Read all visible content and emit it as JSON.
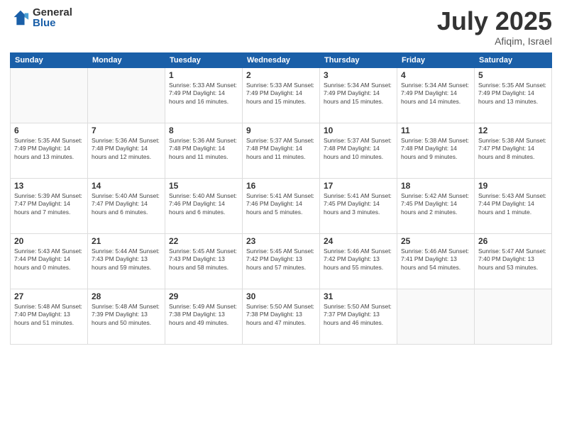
{
  "logo": {
    "general": "General",
    "blue": "Blue"
  },
  "title": {
    "month_year": "July 2025",
    "location": "Afiqim, Israel"
  },
  "weekdays": [
    "Sunday",
    "Monday",
    "Tuesday",
    "Wednesday",
    "Thursday",
    "Friday",
    "Saturday"
  ],
  "weeks": [
    [
      {
        "day": "",
        "info": ""
      },
      {
        "day": "",
        "info": ""
      },
      {
        "day": "1",
        "info": "Sunrise: 5:33 AM\nSunset: 7:49 PM\nDaylight: 14 hours and 16 minutes."
      },
      {
        "day": "2",
        "info": "Sunrise: 5:33 AM\nSunset: 7:49 PM\nDaylight: 14 hours and 15 minutes."
      },
      {
        "day": "3",
        "info": "Sunrise: 5:34 AM\nSunset: 7:49 PM\nDaylight: 14 hours and 15 minutes."
      },
      {
        "day": "4",
        "info": "Sunrise: 5:34 AM\nSunset: 7:49 PM\nDaylight: 14 hours and 14 minutes."
      },
      {
        "day": "5",
        "info": "Sunrise: 5:35 AM\nSunset: 7:49 PM\nDaylight: 14 hours and 13 minutes."
      }
    ],
    [
      {
        "day": "6",
        "info": "Sunrise: 5:35 AM\nSunset: 7:49 PM\nDaylight: 14 hours and 13 minutes."
      },
      {
        "day": "7",
        "info": "Sunrise: 5:36 AM\nSunset: 7:48 PM\nDaylight: 14 hours and 12 minutes."
      },
      {
        "day": "8",
        "info": "Sunrise: 5:36 AM\nSunset: 7:48 PM\nDaylight: 14 hours and 11 minutes."
      },
      {
        "day": "9",
        "info": "Sunrise: 5:37 AM\nSunset: 7:48 PM\nDaylight: 14 hours and 11 minutes."
      },
      {
        "day": "10",
        "info": "Sunrise: 5:37 AM\nSunset: 7:48 PM\nDaylight: 14 hours and 10 minutes."
      },
      {
        "day": "11",
        "info": "Sunrise: 5:38 AM\nSunset: 7:48 PM\nDaylight: 14 hours and 9 minutes."
      },
      {
        "day": "12",
        "info": "Sunrise: 5:38 AM\nSunset: 7:47 PM\nDaylight: 14 hours and 8 minutes."
      }
    ],
    [
      {
        "day": "13",
        "info": "Sunrise: 5:39 AM\nSunset: 7:47 PM\nDaylight: 14 hours and 7 minutes."
      },
      {
        "day": "14",
        "info": "Sunrise: 5:40 AM\nSunset: 7:47 PM\nDaylight: 14 hours and 6 minutes."
      },
      {
        "day": "15",
        "info": "Sunrise: 5:40 AM\nSunset: 7:46 PM\nDaylight: 14 hours and 6 minutes."
      },
      {
        "day": "16",
        "info": "Sunrise: 5:41 AM\nSunset: 7:46 PM\nDaylight: 14 hours and 5 minutes."
      },
      {
        "day": "17",
        "info": "Sunrise: 5:41 AM\nSunset: 7:45 PM\nDaylight: 14 hours and 3 minutes."
      },
      {
        "day": "18",
        "info": "Sunrise: 5:42 AM\nSunset: 7:45 PM\nDaylight: 14 hours and 2 minutes."
      },
      {
        "day": "19",
        "info": "Sunrise: 5:43 AM\nSunset: 7:44 PM\nDaylight: 14 hours and 1 minute."
      }
    ],
    [
      {
        "day": "20",
        "info": "Sunrise: 5:43 AM\nSunset: 7:44 PM\nDaylight: 14 hours and 0 minutes."
      },
      {
        "day": "21",
        "info": "Sunrise: 5:44 AM\nSunset: 7:43 PM\nDaylight: 13 hours and 59 minutes."
      },
      {
        "day": "22",
        "info": "Sunrise: 5:45 AM\nSunset: 7:43 PM\nDaylight: 13 hours and 58 minutes."
      },
      {
        "day": "23",
        "info": "Sunrise: 5:45 AM\nSunset: 7:42 PM\nDaylight: 13 hours and 57 minutes."
      },
      {
        "day": "24",
        "info": "Sunrise: 5:46 AM\nSunset: 7:42 PM\nDaylight: 13 hours and 55 minutes."
      },
      {
        "day": "25",
        "info": "Sunrise: 5:46 AM\nSunset: 7:41 PM\nDaylight: 13 hours and 54 minutes."
      },
      {
        "day": "26",
        "info": "Sunrise: 5:47 AM\nSunset: 7:40 PM\nDaylight: 13 hours and 53 minutes."
      }
    ],
    [
      {
        "day": "27",
        "info": "Sunrise: 5:48 AM\nSunset: 7:40 PM\nDaylight: 13 hours and 51 minutes."
      },
      {
        "day": "28",
        "info": "Sunrise: 5:48 AM\nSunset: 7:39 PM\nDaylight: 13 hours and 50 minutes."
      },
      {
        "day": "29",
        "info": "Sunrise: 5:49 AM\nSunset: 7:38 PM\nDaylight: 13 hours and 49 minutes."
      },
      {
        "day": "30",
        "info": "Sunrise: 5:50 AM\nSunset: 7:38 PM\nDaylight: 13 hours and 47 minutes."
      },
      {
        "day": "31",
        "info": "Sunrise: 5:50 AM\nSunset: 7:37 PM\nDaylight: 13 hours and 46 minutes."
      },
      {
        "day": "",
        "info": ""
      },
      {
        "day": "",
        "info": ""
      }
    ]
  ]
}
